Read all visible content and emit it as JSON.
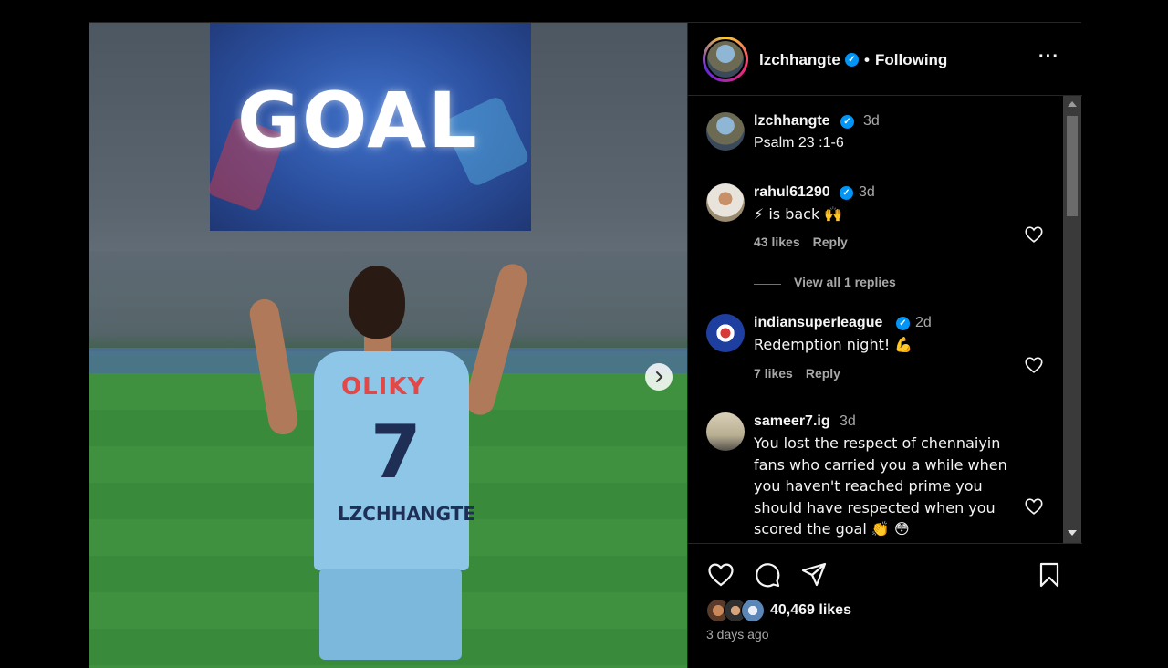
{
  "post": {
    "media": {
      "screen_text": "GOAL",
      "jersey_sponsor": "OLIKY",
      "jersey_number": "7",
      "jersey_name": "LZCHHANGTE"
    },
    "header": {
      "username": "lzchhangte",
      "verified_mark": "✓",
      "separator": "•",
      "follow_status": "Following",
      "more": "···"
    },
    "caption": {
      "username": "lzchhangte",
      "time": "3d",
      "text": "Psalm 23 :1-6"
    },
    "comments": [
      {
        "username": "rahul61290",
        "verified": true,
        "time": "3d",
        "text": "⚡ is back 🙌",
        "likes": "43 likes",
        "reply": "Reply",
        "view_replies": "View all 1 replies"
      },
      {
        "username": "indiansuperleague",
        "verified": true,
        "time": "2d",
        "text": "Redemption night! 💪",
        "likes": "7 likes",
        "reply": "Reply"
      },
      {
        "username": "sameer7.ig",
        "verified": false,
        "time": "3d",
        "text": "You lost the respect of chennaiyin fans who carried you a while when you haven't reached prime you should have respected when you scored the goal 👏 😳"
      }
    ],
    "likes_count": "40,469 likes",
    "posted_ago": "3 days ago",
    "colors": {
      "verified": "#0095f6",
      "secondary_text": "#a8a8a8",
      "background": "#000000"
    },
    "icons": [
      "heart-icon",
      "comment-icon",
      "share-icon",
      "save-icon",
      "more-icon",
      "chevron-right-icon"
    ]
  }
}
